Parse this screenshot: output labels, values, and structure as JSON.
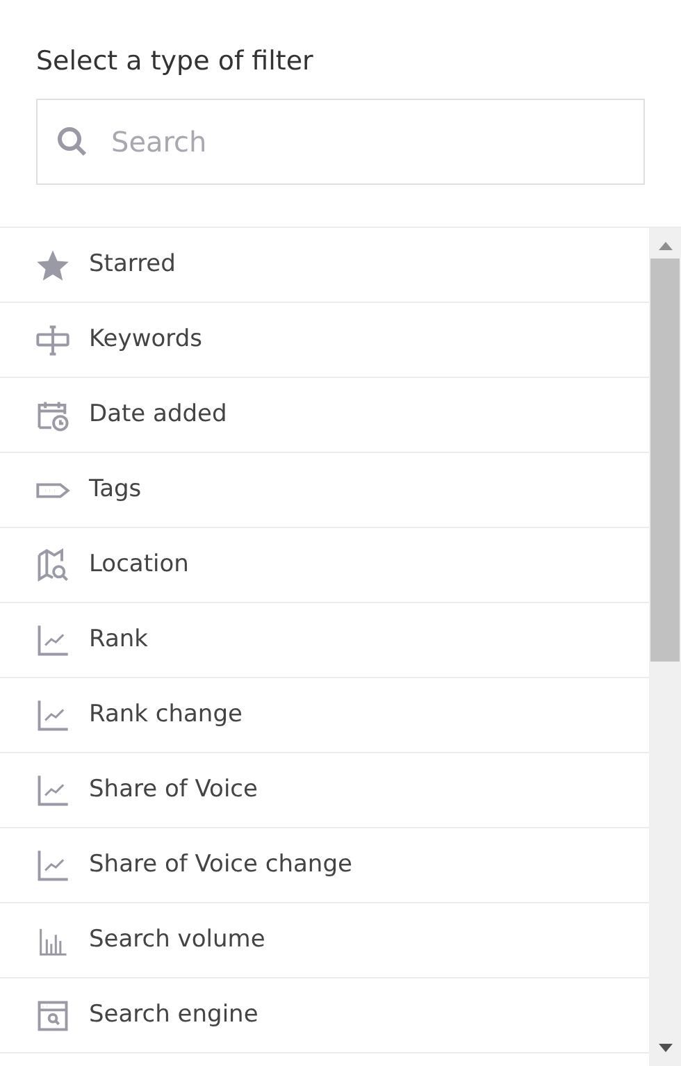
{
  "title": "Select a type of filter",
  "search": {
    "placeholder": "Search"
  },
  "items": [
    {
      "label": "Starred",
      "kind": "starred"
    },
    {
      "label": "Keywords",
      "kind": "keyword"
    },
    {
      "label": "Date added",
      "kind": "date"
    },
    {
      "label": "Tags",
      "kind": "tag"
    },
    {
      "label": "Location",
      "kind": "location"
    },
    {
      "label": "Rank",
      "kind": "metric"
    },
    {
      "label": "Rank change",
      "kind": "metric"
    },
    {
      "label": "Share of Voice",
      "kind": "metric"
    },
    {
      "label": "Share of Voice change",
      "kind": "metric"
    },
    {
      "label": "Search volume",
      "kind": "volume"
    },
    {
      "label": "Search engine",
      "kind": "engine"
    }
  ]
}
